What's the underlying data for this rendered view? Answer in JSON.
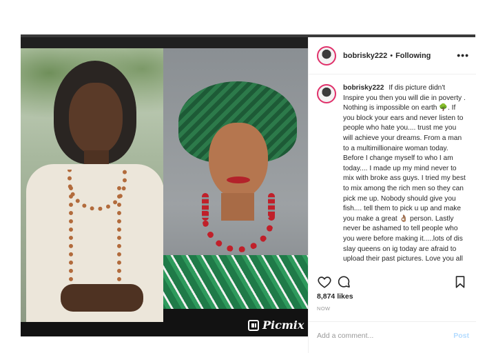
{
  "post": {
    "username": "bobrisky222",
    "follow_separator": "•",
    "follow_status": "Following",
    "more_label": "•••",
    "caption_user": "bobrisky222",
    "caption_text": "If dis picture didn't Inspire you then you will die in poverty . Nothing is impossible on earth 🌳. If you block your ears and never listen to people who hate you.... trust me you will achieve your dreams. From a man to a multimillionaire woman today. Before I change myself to who I am today.... I made up my mind never to mix with broke ass guys. I tried my best to mix among the rich men so they can pick me up. Nobody should give you fish.... tell them to pick u up and make you make a great 👌🏽 person. Lastly never be ashamed to tell people who you were before making it.....lots of dis slay queens on ig today are afraid to upload their past pictures. Love you all",
    "likes": "8,874 likes",
    "date": "NOW",
    "comment_placeholder": "Add a comment...",
    "post_button": "Post",
    "watermark": "Picmix"
  },
  "icons": {
    "like": "heart-icon",
    "comment": "comment-icon",
    "save": "bookmark-icon",
    "more": "more-options-icon"
  },
  "colors": {
    "avatar_ring": "#e0306a",
    "post_button_disabled": "#b3dbff",
    "muted_text": "#999999"
  }
}
